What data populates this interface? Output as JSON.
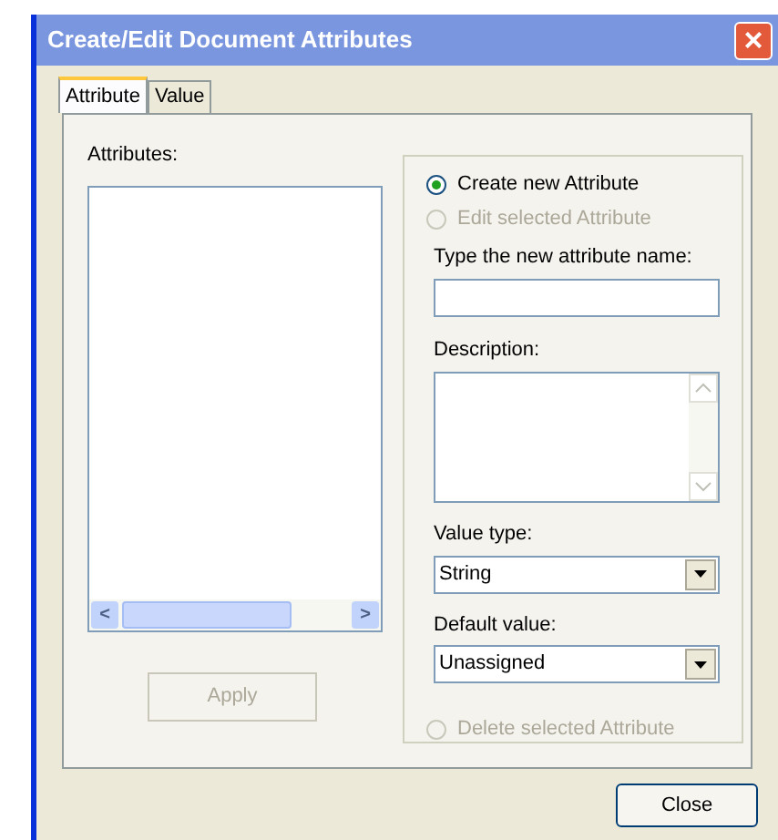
{
  "window": {
    "title": "Create/Edit Document Attributes",
    "close": "×"
  },
  "tabs": [
    {
      "label": "Attribute",
      "selected": true
    },
    {
      "label": "Value",
      "selected": false
    }
  ],
  "attributes": {
    "label": "Attributes:",
    "scroll_left": "<",
    "scroll_right": ">"
  },
  "apply_button": {
    "label": "Apply",
    "disabled": true
  },
  "mode_options": [
    {
      "label": "Create new Attribute",
      "selected": true,
      "disabled": false
    },
    {
      "label": "Edit selected Attribute",
      "selected": false,
      "disabled": true
    }
  ],
  "name_field": {
    "label": "Type the new attribute name:"
  },
  "description": {
    "label": "Description:"
  },
  "value_type": {
    "label": "Value type:",
    "value": "String"
  },
  "default_value": {
    "label": "Default value:",
    "value": "Unassigned"
  },
  "delete_option": {
    "label": "Delete selected Attribute",
    "selected": false,
    "disabled": true
  },
  "close_button": "Close"
}
